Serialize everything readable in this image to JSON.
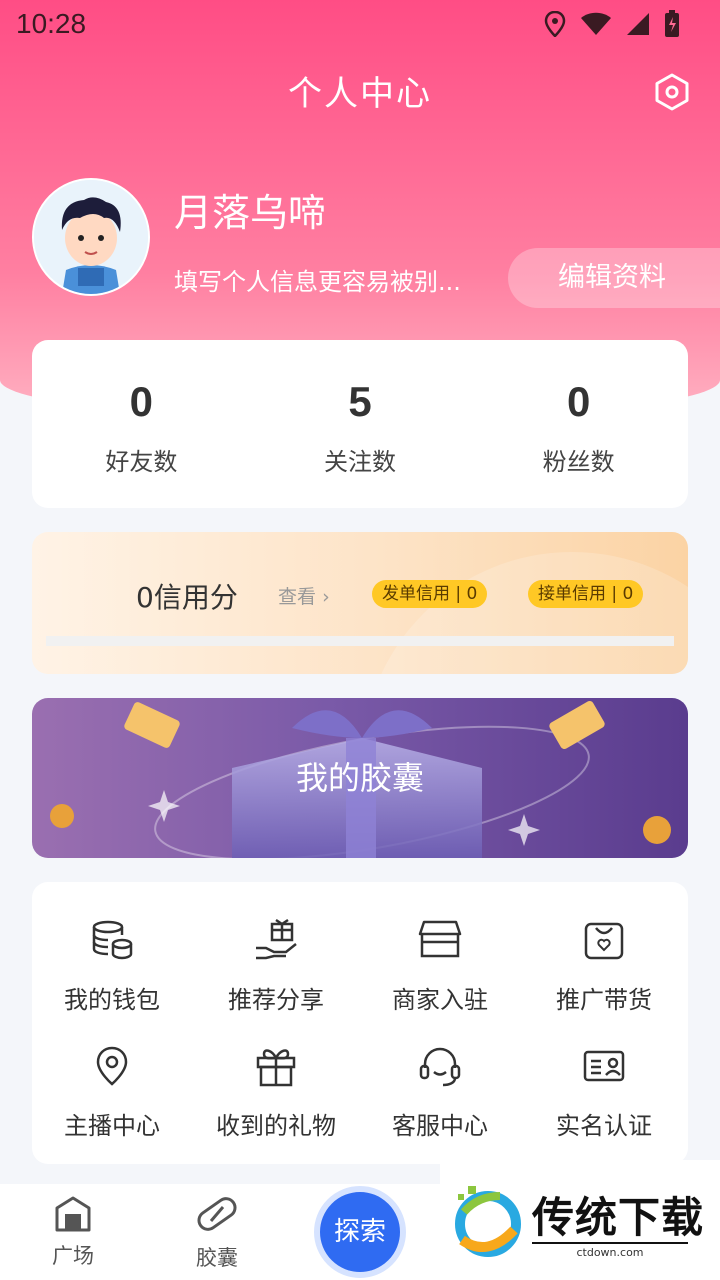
{
  "status_bar": {
    "time": "10:28"
  },
  "header": {
    "title": "个人中心"
  },
  "profile": {
    "name": "月落乌啼",
    "bio": "填写个人信息更容易被别...",
    "edit_label": "编辑资料"
  },
  "stats": [
    {
      "value": "0",
      "label": "好友数"
    },
    {
      "value": "5",
      "label": "关注数"
    },
    {
      "value": "0",
      "label": "粉丝数"
    }
  ],
  "credit": {
    "score_text": "0信用分",
    "view_label": "查看",
    "order_credit": "发单信用 | 0",
    "take_credit": "接单信用 | 0",
    "progress": 0
  },
  "capsule_banner": {
    "label": "我的胶囊"
  },
  "menu": [
    {
      "label": "我的钱包",
      "icon": "wallet-coins-icon"
    },
    {
      "label": "推荐分享",
      "icon": "gift-hand-icon"
    },
    {
      "label": "商家入驻",
      "icon": "store-icon"
    },
    {
      "label": "推广带货",
      "icon": "shopping-bag-icon"
    },
    {
      "label": "主播中心",
      "icon": "location-pin-icon"
    },
    {
      "label": "收到的礼物",
      "icon": "gift-box-icon"
    },
    {
      "label": "客服中心",
      "icon": "headset-icon"
    },
    {
      "label": "实名认证",
      "icon": "id-card-icon"
    }
  ],
  "tabbar": {
    "plaza": "广场",
    "capsule": "胶囊",
    "explore": "探索"
  },
  "watermark": {
    "title": "传统下载",
    "url": "ctdown.com"
  },
  "colors": {
    "primary_pink": "#ff4d85",
    "explore_blue": "#2f6bf2",
    "badge_yellow": "#ffc825"
  }
}
